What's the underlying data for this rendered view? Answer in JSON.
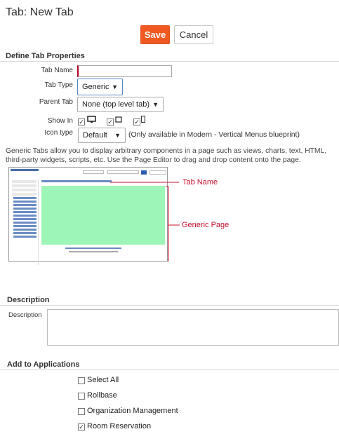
{
  "page": {
    "title": "Tab: New Tab"
  },
  "toolbar": {
    "save_label": "Save",
    "cancel_label": "Cancel"
  },
  "define": {
    "heading": "Define Tab Properties",
    "tab_name_label": "Tab Name",
    "tab_name_value": "",
    "tab_type_label": "Tab Type",
    "tab_type_value": "Generic",
    "parent_tab_label": "Parent Tab",
    "parent_tab_value": "None (top level tab)",
    "show_in_label": "Show In",
    "show_in": [
      {
        "icon": "desktop-icon",
        "checked": true
      },
      {
        "icon": "tablet-icon",
        "checked": true
      },
      {
        "icon": "mobile-icon",
        "checked": true
      }
    ],
    "icon_type_label": "Icon type",
    "icon_type_value": "Default",
    "icon_type_note": "(Only available in Modern - Vertical Menus blueprint)",
    "description_text": "Generic Tabs allow you to display arbitrary components in a page such as views, charts, text, HTML, third-party widgets, scripts, etc. Use the Page Editor to drag and drop content onto the page."
  },
  "preview": {
    "tab_name_annotation": "Tab Name",
    "generic_page_annotation": "Generic Page",
    "page_color": "#9ef5b8",
    "annotation_color": "#c8102e"
  },
  "description": {
    "heading": "Description",
    "label": "Description",
    "value": ""
  },
  "applications": {
    "heading": "Add to Applications",
    "items": [
      {
        "label": "Select All",
        "checked": false
      },
      {
        "label": "Rollbase",
        "checked": false
      },
      {
        "label": "Organization Management",
        "checked": false
      },
      {
        "label": "Room Reservation",
        "checked": true
      }
    ]
  },
  "colors": {
    "accent": "#f05a22",
    "required": "#b00020"
  }
}
